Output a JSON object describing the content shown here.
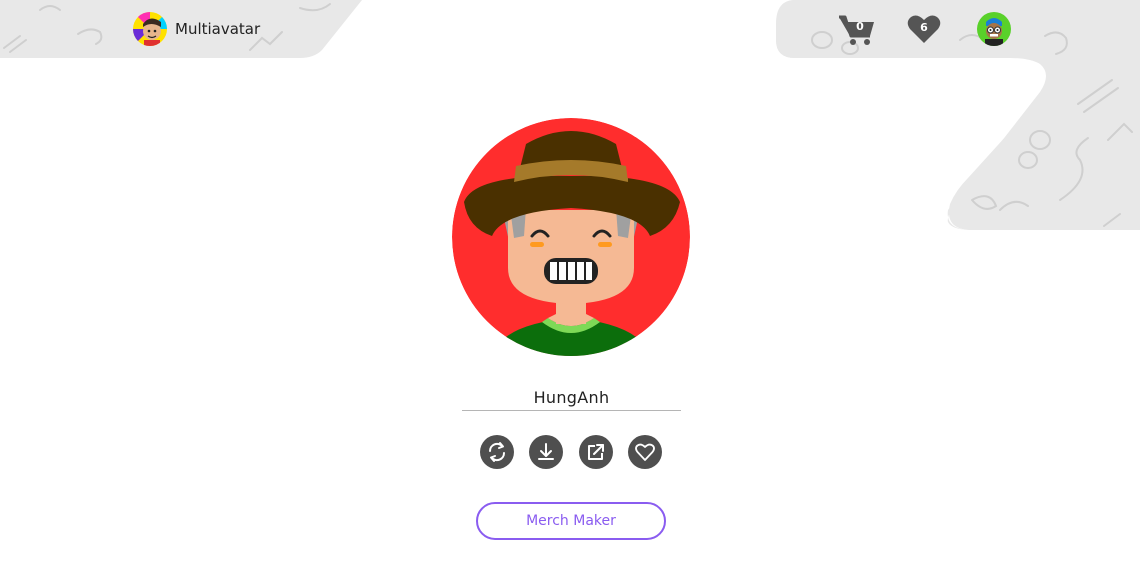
{
  "brand": {
    "name": "Multiavatar"
  },
  "header": {
    "cart_count": "0",
    "favorites_count": "6"
  },
  "avatar": {
    "name_value": "HungAnh",
    "background_color": "#ff2d2d",
    "hat_color": "#4a3000",
    "hat_band_color": "#a57a2a",
    "skin_color": "#f5b994",
    "hair_color": "#a0a0a0",
    "shirt_color": "#0c6e0c",
    "collar_color": "#7ed957"
  },
  "actions": {
    "refresh_icon": "refresh-icon",
    "download_icon": "download-icon",
    "share_icon": "external-link-icon",
    "favorite_icon": "heart-outline-icon"
  },
  "merch": {
    "label": "Merch Maker"
  },
  "colors": {
    "accent": "#8a5cf0",
    "icon_dark": "#4f4f4f",
    "backdrop_gray": "#e8e8e8"
  }
}
